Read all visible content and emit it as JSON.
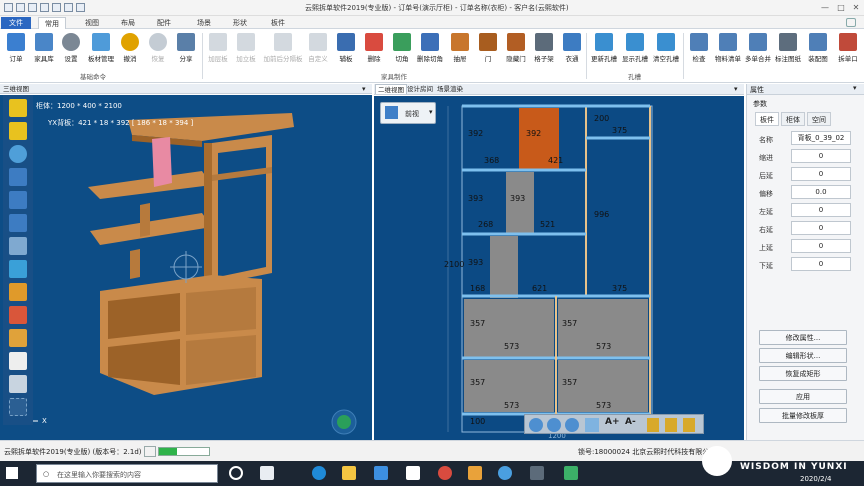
{
  "titlebar": {
    "title": "云熙拆单软件2019(专业版) - 订单号(演示厅柜) - 订单名称(衣柜) - 客户名(云熙软件)",
    "minimize": "—",
    "maximize": "□",
    "close": "✕"
  },
  "tabs": [
    {
      "label": "文件"
    },
    {
      "label": "常用"
    },
    {
      "label": "视图"
    },
    {
      "label": "布局"
    },
    {
      "label": "配件"
    },
    {
      "label": "场景"
    },
    {
      "label": "形状"
    },
    {
      "label": "板件"
    }
  ],
  "ribbon": {
    "buttons": [
      {
        "label": "订单",
        "color": "#3b7fd0"
      },
      {
        "label": "家具库",
        "color": "#4a86c8"
      },
      {
        "label": "设置",
        "color": "#7b8794"
      },
      {
        "label": "板材管理",
        "color": "#4f9bd9"
      },
      {
        "label": "撤消",
        "color": "#e0a200"
      },
      {
        "label": "恢复",
        "color": "#9aa6b2"
      },
      {
        "label": "分享",
        "color": "#5a7fa8"
      },
      {
        "label": "加层板",
        "color": "#b6c0cb"
      },
      {
        "label": "加立板",
        "color": "#b6c0cb"
      },
      {
        "label": "加前后分隔板",
        "color": "#b6c0cb"
      },
      {
        "label": "自定义",
        "color": "#b6c0cb"
      },
      {
        "label": "辅板",
        "color": "#3a6db0"
      },
      {
        "label": "删除",
        "color": "#d94b3f"
      },
      {
        "label": "切角",
        "color": "#3a9e5c"
      },
      {
        "label": "删除切角",
        "color": "#3c6fb8"
      },
      {
        "label": "抽屉",
        "color": "#c8762c"
      },
      {
        "label": "门",
        "color": "#a85d1f"
      },
      {
        "label": "隐藏门",
        "color": "#b25e24"
      },
      {
        "label": "格子架",
        "color": "#5c6b7a"
      },
      {
        "label": "衣通",
        "color": "#3d7cc2"
      },
      {
        "label": "更新孔槽",
        "color": "#3a8fd0"
      },
      {
        "label": "显示孔槽",
        "color": "#3a8fd0"
      },
      {
        "label": "清空孔槽",
        "color": "#3a8fd0"
      },
      {
        "label": "检查",
        "color": "#4f7fb7"
      },
      {
        "label": "物料清单",
        "color": "#4f7fb7"
      },
      {
        "label": "多单合并",
        "color": "#4f7fb7"
      },
      {
        "label": "标注图纸",
        "color": "#5d6d7d"
      },
      {
        "label": "装配图",
        "color": "#4f7fb7"
      },
      {
        "label": "拆单口",
        "color": "#c04a3a"
      }
    ],
    "groups": [
      {
        "label": "基础命令"
      },
      {
        "label": "家具制作"
      },
      {
        "label": "孔槽"
      }
    ]
  },
  "view3d": {
    "tab": "三维视图",
    "dims": "柜体：1200 * 400 * 2100",
    "board": "YX背板：421 * 18 * 392 [ 186 * 18 * 394 ]",
    "axis_x": "X"
  },
  "view2d": {
    "tabs": [
      {
        "label": "二维视图"
      },
      {
        "label": "设计房间"
      },
      {
        "label": "场景渲染"
      }
    ],
    "view_select": "前视",
    "labels": [
      "392",
      "392",
      "368",
      "421",
      "200",
      "375",
      "393",
      "393",
      "268",
      "521",
      "996",
      "393",
      "168",
      "621",
      "375",
      "357",
      "357",
      "573",
      "573",
      "357",
      "357",
      "573",
      "573",
      "100",
      "2100",
      "1200"
    ]
  },
  "props": {
    "title": "属性",
    "section": "参数",
    "tabs": [
      {
        "label": "板件"
      },
      {
        "label": "柜体"
      },
      {
        "label": "空间"
      }
    ],
    "rows": [
      {
        "k": "名称",
        "v": "背板_0_39_02"
      },
      {
        "k": "缩进",
        "v": "0"
      },
      {
        "k": "后延",
        "v": "0"
      },
      {
        "k": "偏移",
        "v": "0.0"
      },
      {
        "k": "左延",
        "v": "0"
      },
      {
        "k": "右延",
        "v": "0"
      },
      {
        "k": "上延",
        "v": "0"
      },
      {
        "k": "下延",
        "v": "0"
      }
    ],
    "buttons": [
      {
        "label": "修改属性..."
      },
      {
        "label": "编辑形状..."
      },
      {
        "label": "恢复成矩形"
      },
      {
        "label": "应用"
      },
      {
        "label": "批量修改板厚"
      }
    ]
  },
  "status": {
    "left": "云熙拆单软件2019(专业版)  (版本号：2.1d)",
    "right": "锁号:18000024 北京云熙时代科技有限公司"
  },
  "taskbar": {
    "search": "在这里输入你要搜索的内容",
    "date": "2020/2/4"
  },
  "watermark": {
    "text": "WISDOM IN YUNXI"
  }
}
